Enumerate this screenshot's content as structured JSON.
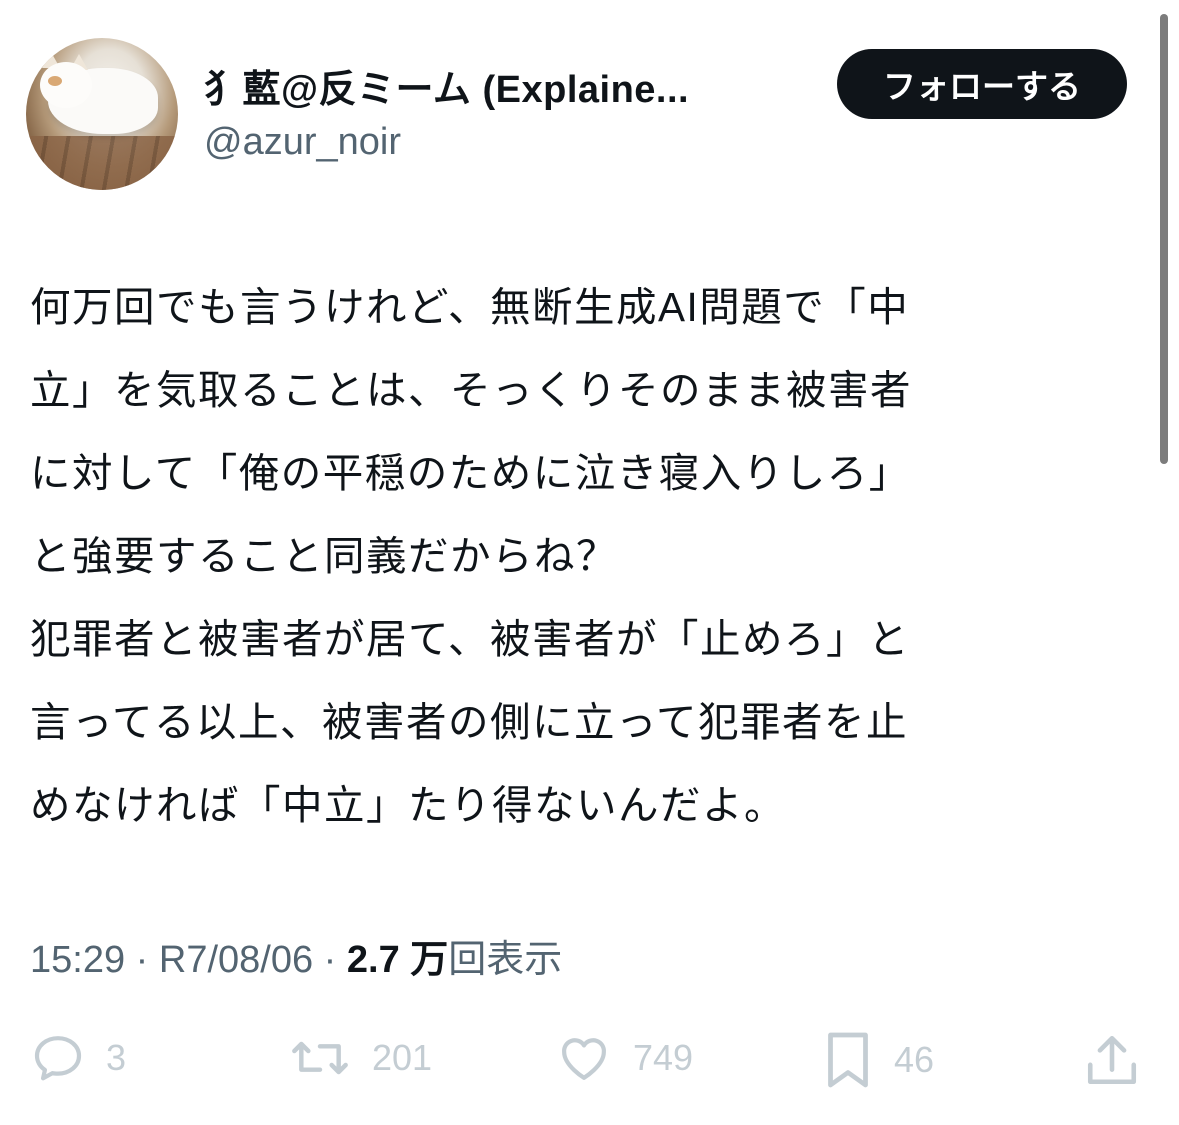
{
  "author": {
    "display_name": "犭藍@反ミーム (Explaine...",
    "handle": "@azur_noir",
    "avatar_icon": "cat-avatar"
  },
  "follow_button": {
    "label": "フォローする"
  },
  "tweet": {
    "lines": [
      "何万回でも言うけれど、無断生成AI問題で「中",
      "立」を気取ることは、そっくりそのまま被害者",
      "に対して「俺の平穏のために泣き寝入りしろ」",
      "と強要すること同義だからね？",
      "犯罪者と被害者が居て、被害者が「止めろ」と",
      "言ってる以上、被害者の側に立って犯罪者を止",
      "めなければ「中立」たり得ないんだよ。"
    ]
  },
  "meta": {
    "time": "15:29",
    "sep1": " · ",
    "date": "R7/08/06",
    "sep2": " · ",
    "views_count": "2.7 万",
    "views_label": "回表示"
  },
  "actions": {
    "replies": {
      "icon": "reply-icon",
      "count": "3"
    },
    "reposts": {
      "icon": "repost-icon",
      "count": "201"
    },
    "likes": {
      "icon": "heart-icon",
      "count": "749"
    },
    "bookmarks": {
      "icon": "bookmark-icon",
      "count": "46"
    },
    "share": {
      "icon": "share-icon"
    }
  },
  "colors": {
    "text": "#0f1419",
    "secondary": "#536471",
    "action_icons": "#c4cdd3",
    "button_bg": "#0f1419"
  }
}
